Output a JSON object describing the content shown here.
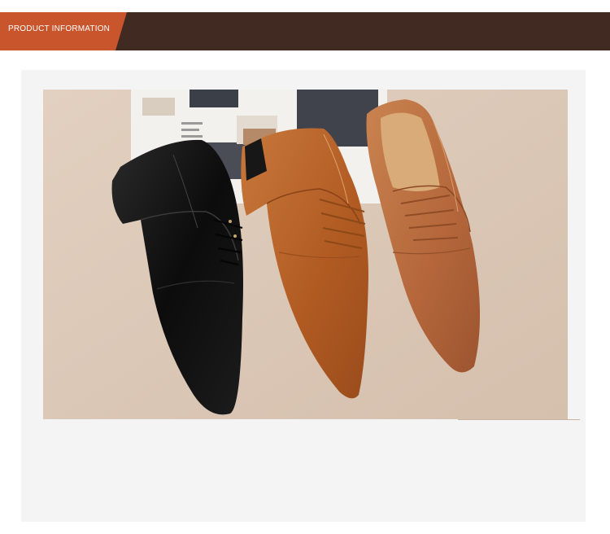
{
  "header": {
    "title": "PRODUCT INFORMATION",
    "tab_color": "#c9552c",
    "bar_color": "#412a22"
  },
  "product_image": {
    "subject": "three pointed-toe lace-up derby shoes: black, tan, brown",
    "background_color": "#dcc9b8",
    "shoe_colors": [
      "#101010",
      "#b5602a",
      "#b5673a"
    ]
  }
}
